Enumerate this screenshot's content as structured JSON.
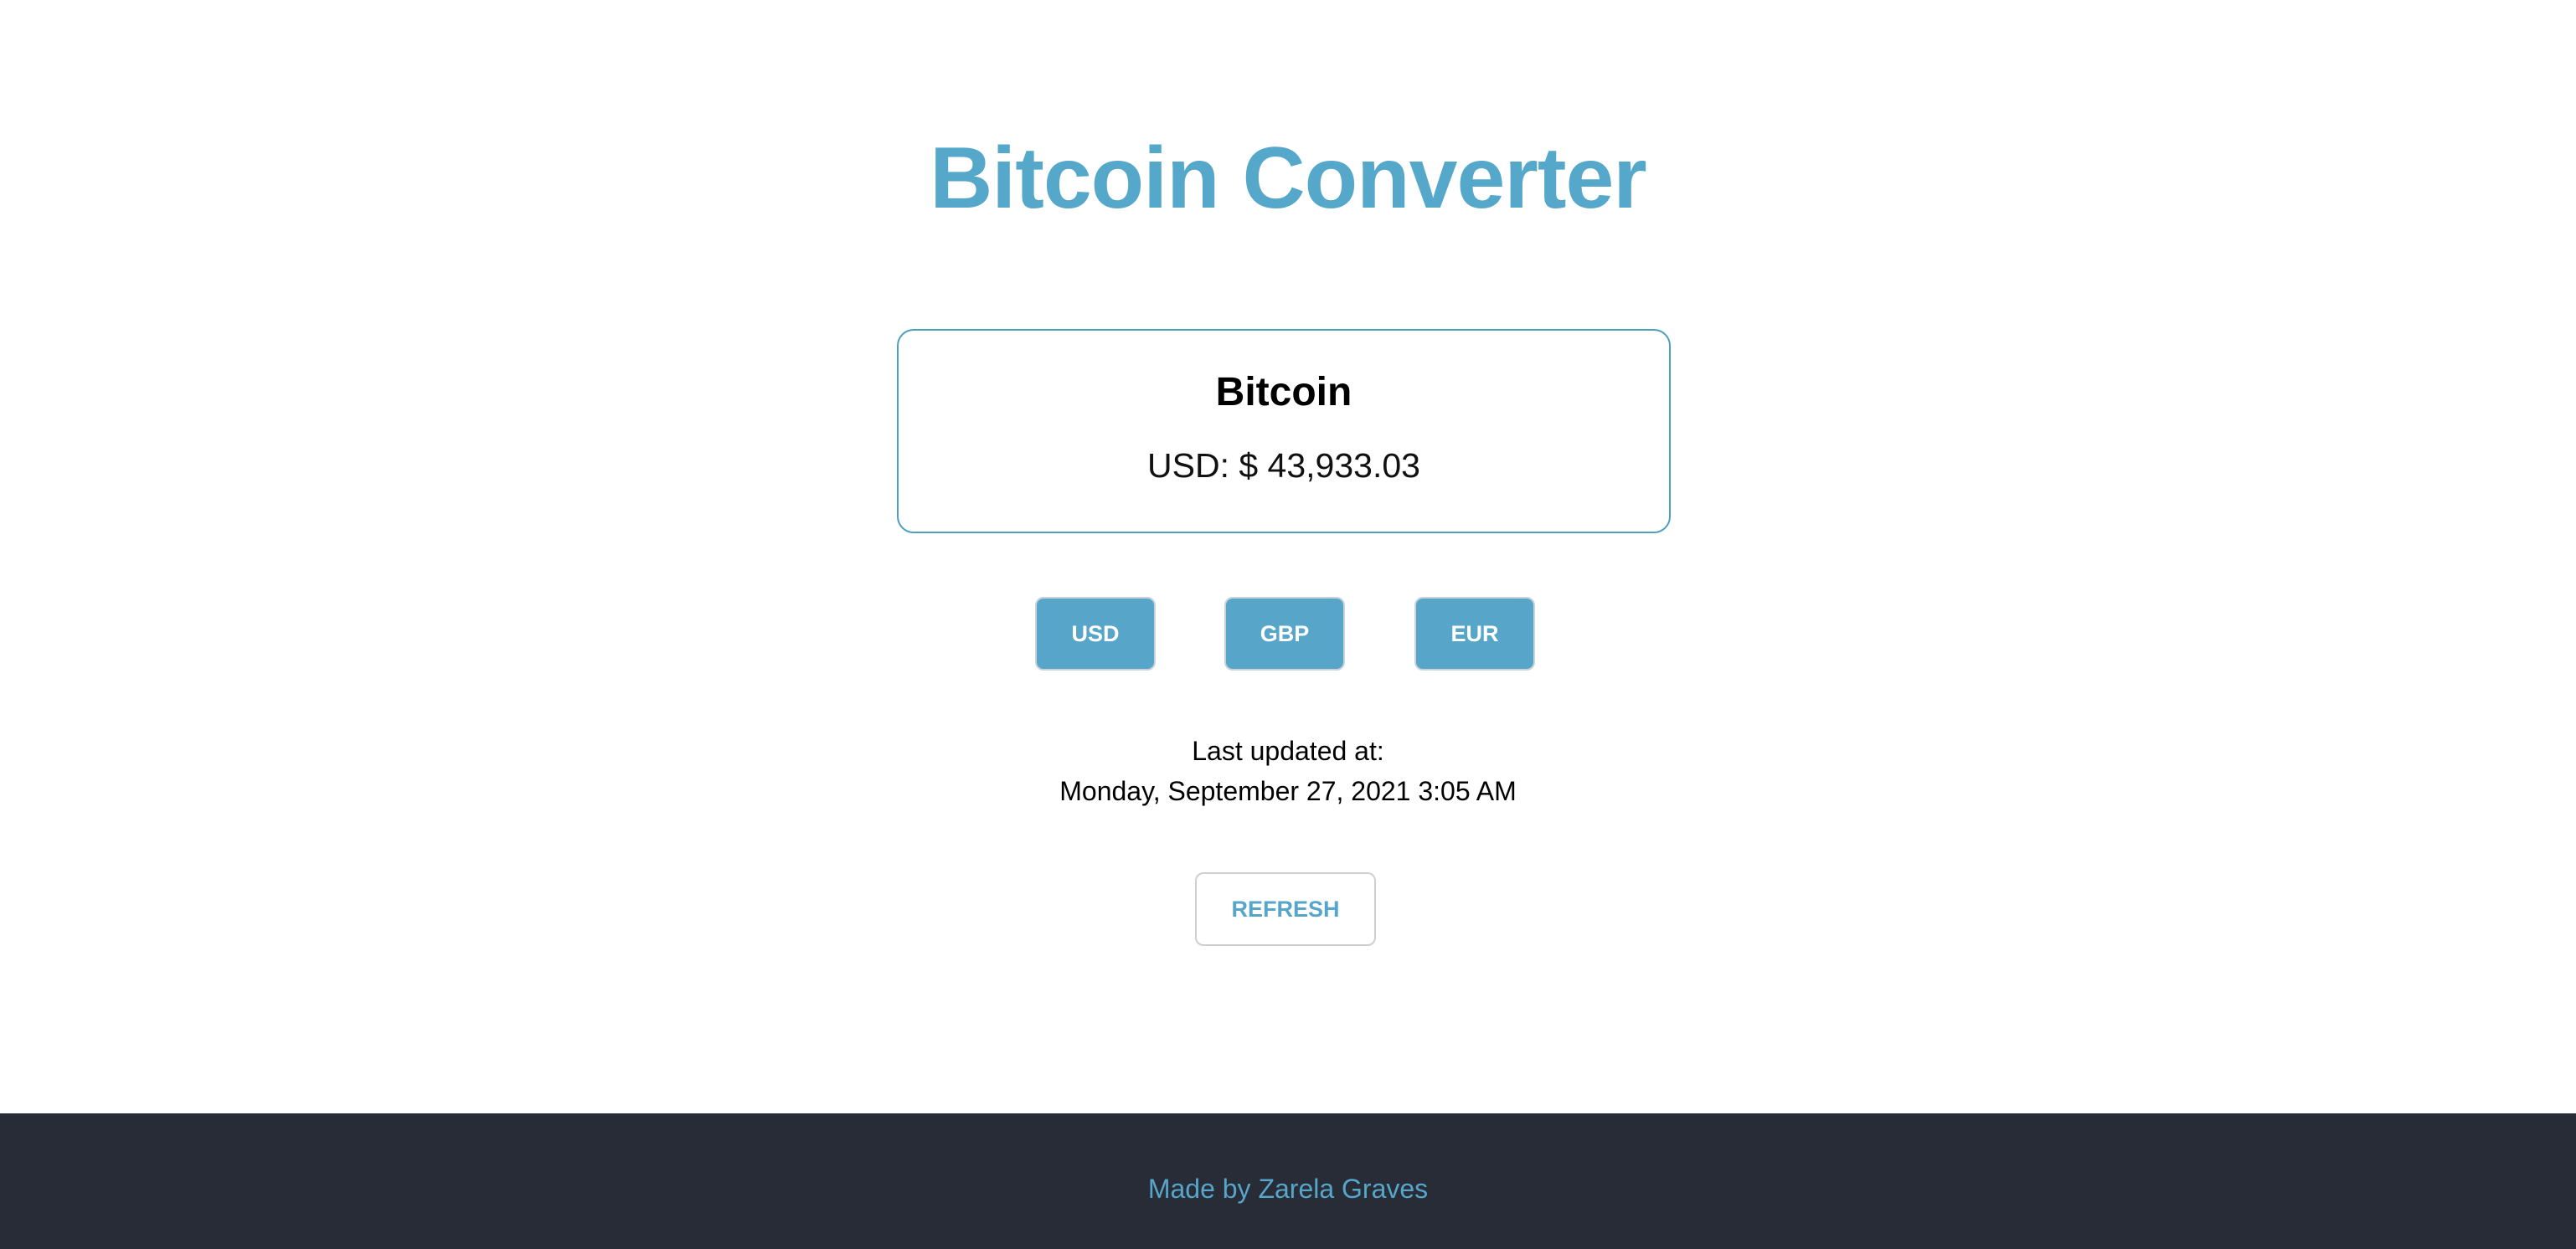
{
  "header": {
    "title": "Bitcoin Converter"
  },
  "card": {
    "title": "Bitcoin",
    "price": "USD: $ 43,933.03"
  },
  "currency_buttons": [
    {
      "label": "USD"
    },
    {
      "label": "GBP"
    },
    {
      "label": "EUR"
    }
  ],
  "updated": {
    "label": "Last updated at:",
    "value": "Monday, September 27, 2021 3:05 AM"
  },
  "refresh": {
    "label": "REFRESH"
  },
  "footer": {
    "credit": "Made by Zarela Graves"
  },
  "colors": {
    "accent": "#56a8cb",
    "card_border": "#4d9fbe",
    "footer_background": "#282c36",
    "page_background": "#ffffff"
  }
}
